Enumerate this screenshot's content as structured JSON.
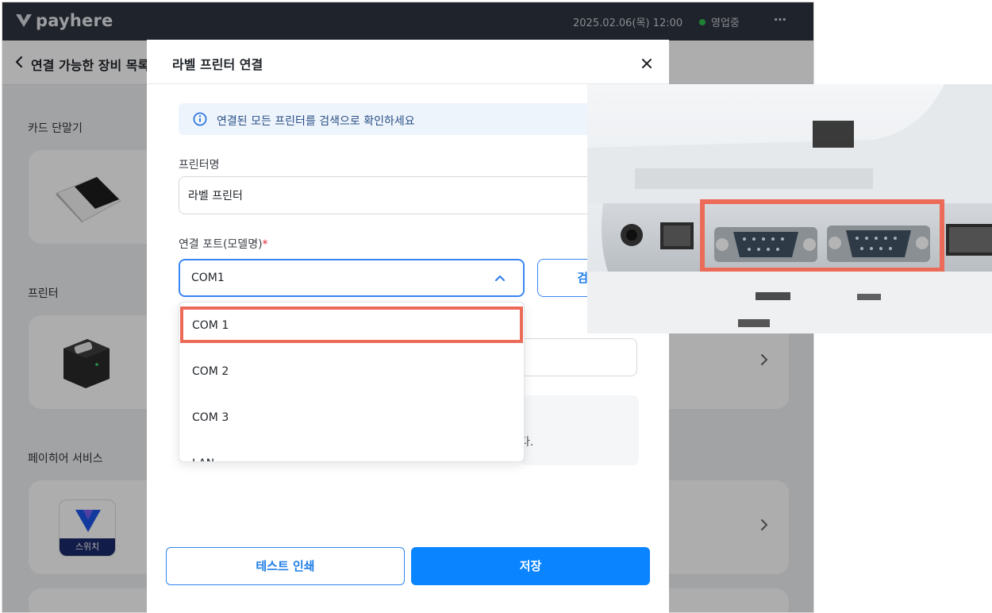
{
  "app": {
    "brand": "payhere",
    "datetime": "2025.02.06(목) 12:00",
    "status": "영업중",
    "more_icon": "⋯"
  },
  "background": {
    "subheader_title": "연결 가능한 장비 목록",
    "sections": [
      {
        "label": "카드 단말기"
      },
      {
        "label": "프린터"
      },
      {
        "label": "페이히어 서비스"
      }
    ],
    "switch_app_label": "스위치"
  },
  "modal": {
    "title": "라벨 프린터 연결",
    "info": "연결된 모든 프린터를 검색으로 확인하세요",
    "printer_name_label": "프린터명",
    "printer_name_value": "라벨 프린터",
    "port_label": "연결 포트(모델명)",
    "required_mark": "*",
    "port_selected": "COM1",
    "search_button": "검색",
    "notice_tail": "다.",
    "dropdown_options": [
      "COM 1",
      "COM 2",
      "COM 3",
      "LAN"
    ],
    "test_print_button": "테스트 인쇄",
    "save_button": "저장"
  },
  "colors": {
    "primary": "#0a84ff",
    "highlight": "#ec6a58",
    "topbar": "#2f3440",
    "status_online": "#2fbf4f"
  }
}
